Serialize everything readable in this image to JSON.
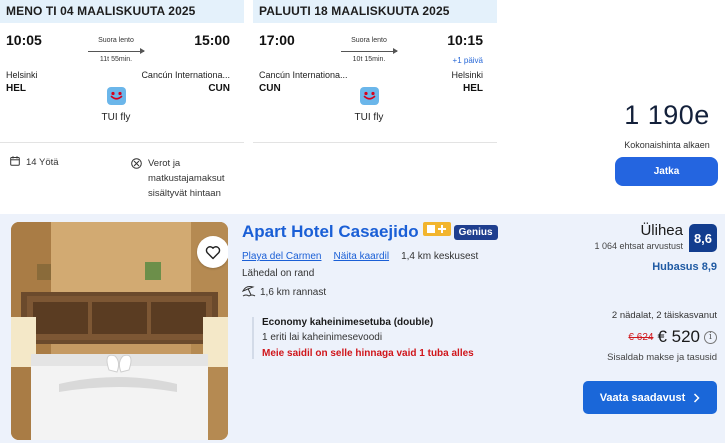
{
  "outbound": {
    "header": "MENO TI 04 MAALISKUUTA 2025",
    "dep_time": "10:05",
    "arr_time": "15:00",
    "stops": "Suora lento",
    "duration": "11t 55min.",
    "dep_city": "Helsinki",
    "dep_code": "HEL",
    "arr_city": "Cancún Internationa...",
    "arr_code": "CUN",
    "airline": "TUI fly"
  },
  "return": {
    "header": "PALUUTI 18 MAALISKUUTA 2025",
    "dep_time": "17:00",
    "arr_time": "10:15",
    "stops": "Suora lento",
    "duration": "10t 15min.",
    "plus_day": "+1 päivä",
    "dep_city": "Cancún Internationa...",
    "dep_code": "CUN",
    "arr_city": "Helsinki",
    "arr_code": "HEL",
    "airline": "TUI fly"
  },
  "trip": {
    "nights": "14 Yötä",
    "taxes": "Verot ja matkustajamaksut sisältyvät hintaan",
    "price": "1 190e",
    "price_label": "Kokonaishinta alkaen",
    "continue_label": "Jatka"
  },
  "hotel": {
    "name": "Apart Hotel Casaejido",
    "genius": "Genius",
    "city": "Playa del Carmen",
    "map_link": "Näita kaardil",
    "distance_center": "1,4 km keskusest",
    "near_beach": "Lähedal on rand",
    "beach_distance": "1,6 km rannast",
    "room_type": "Economy kaheinimesetuba (double)",
    "room_bed": "1 eriti lai kaheinimesevoodi",
    "scarcity": "Meie saidil on selle hinnaga vaid 1 tuba alles",
    "rating_word": "Ülihea",
    "rating_count": "1 064 ehtsat arvustust",
    "score": "8,6",
    "cleanliness": "Hubasus 8,9",
    "occupancy": "2 nädalat, 2 täiskasvanut",
    "old_price": "€ 624",
    "new_price": "€ 520",
    "taxes_included": "Sisaldab makse ja tasusid",
    "cta_label": "Vaata saadavust"
  },
  "colors": {
    "leg_header_bg": "#e4f1fb",
    "primary_button": "#2465e0",
    "hotel_link": "#1a5fd6",
    "score_badge": "#123d8e",
    "scarcity_red": "#d0161b",
    "genius_badge": "#1f3f8f",
    "star_badge": "#f2b52e"
  },
  "icons": {
    "airline_logo": "tui-smile-icon",
    "nights": "calendar-icon",
    "taxes": "no-fees-icon",
    "favorite": "heart-icon",
    "beach": "beach-umbrella-icon",
    "info": "info-icon",
    "cta_arrow": "chevron-right-icon"
  }
}
